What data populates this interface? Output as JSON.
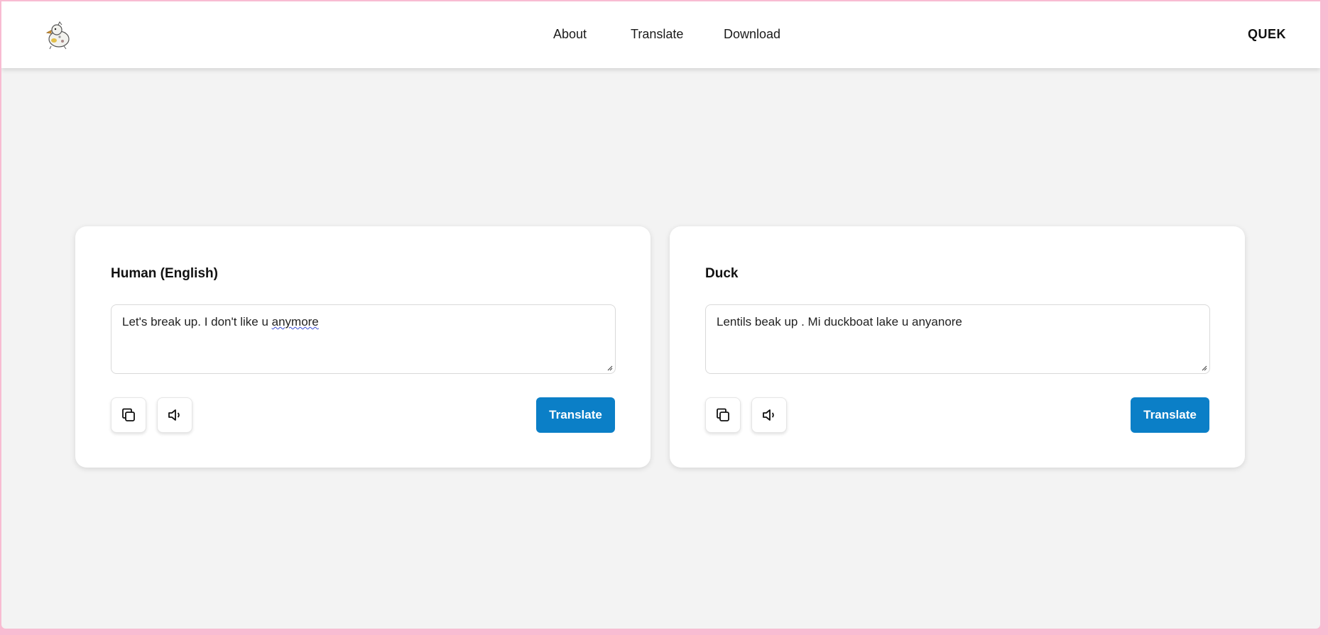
{
  "nav": {
    "logo_icon": "duck-logo-icon",
    "links": [
      "About",
      "Translate",
      "Download"
    ],
    "brand": "QUEK"
  },
  "panels": {
    "left": {
      "title": "Human (English)",
      "text_before": "Let's break up. I don't like u ",
      "text_misspelled": "anymore",
      "copy_icon": "copy-icon",
      "speak_icon": "speaker-icon",
      "translate_label": "Translate"
    },
    "right": {
      "title": "Duck",
      "text": "Lentils beak up . Mi duckboat lake u anyanore",
      "copy_icon": "copy-icon",
      "speak_icon": "speaker-icon",
      "translate_label": "Translate"
    }
  },
  "colors": {
    "accent": "#0b7fc7",
    "window_border": "#f8bcd2",
    "page_bg": "#f3f3f3"
  }
}
